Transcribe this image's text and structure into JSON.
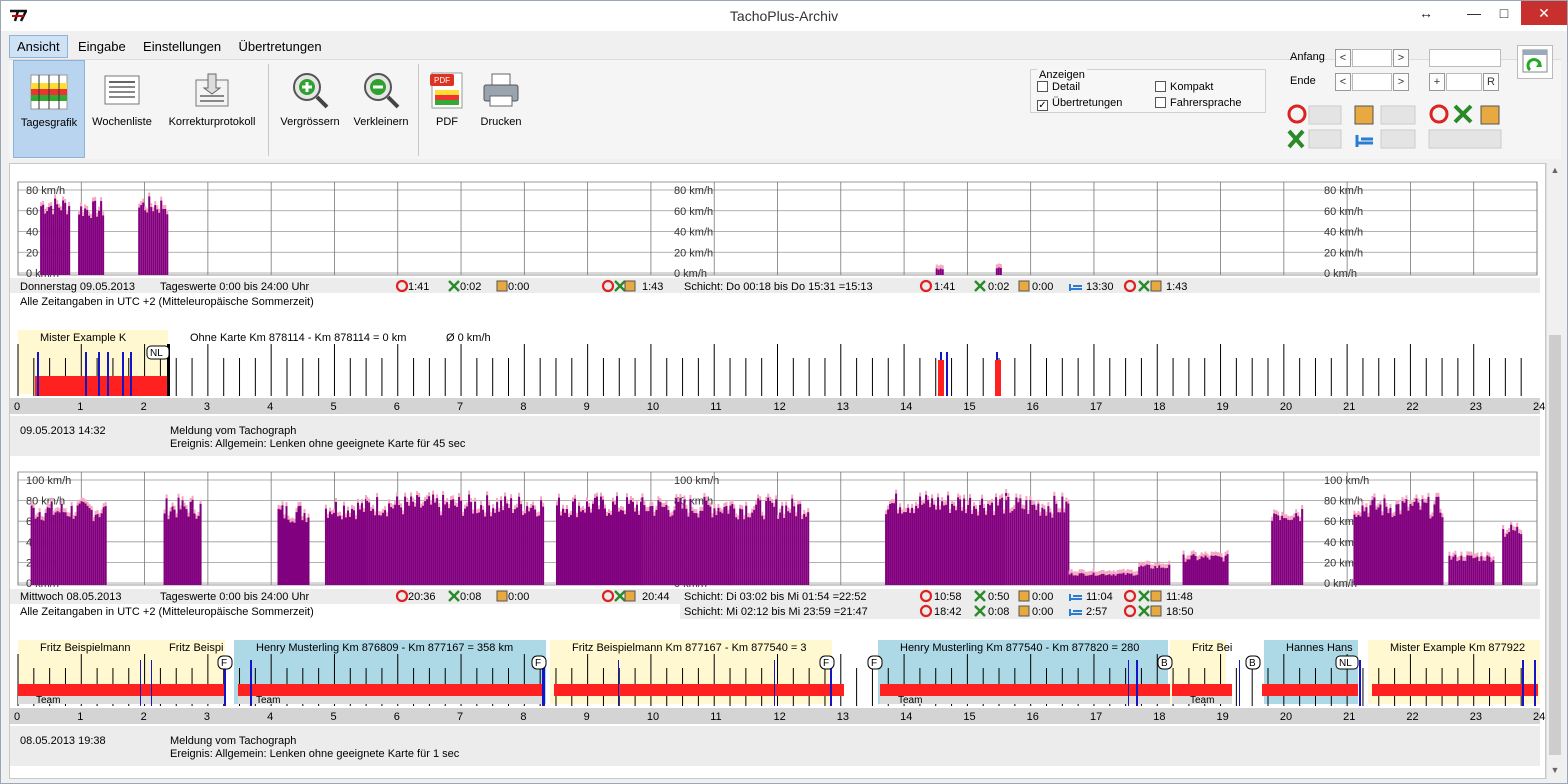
{
  "window": {
    "title": "TachoPlus-Archiv",
    "restore_glyph": "↔",
    "minimize_glyph": "—",
    "maximize_glyph": "□",
    "close_glyph": "✕"
  },
  "menu": {
    "items": [
      "Ansicht",
      "Eingabe",
      "Einstellungen",
      "Übertretungen"
    ],
    "active": "Ansicht"
  },
  "ribbon": {
    "buttons": [
      {
        "label": "Tagesgrafik",
        "icon": "tagesgrafik-icon",
        "selected": true
      },
      {
        "label": "Wochenliste",
        "icon": "wochenliste-icon"
      },
      {
        "label": "Korrekturprotokoll",
        "icon": "korrekturprotokoll-icon"
      },
      {
        "label": "Vergrössern",
        "icon": "zoom-in-icon"
      },
      {
        "label": "Verkleinern",
        "icon": "zoom-out-icon"
      },
      {
        "label": "PDF",
        "icon": "pdf-icon"
      },
      {
        "label": "Drucken",
        "icon": "printer-icon"
      }
    ],
    "anzeigen": {
      "title": "Anzeigen",
      "options": [
        {
          "label": "Detail",
          "checked": false
        },
        {
          "label": "Kompakt",
          "checked": false
        },
        {
          "label": "Übertretungen",
          "checked": true
        },
        {
          "label": "Fahrersprache",
          "checked": false
        }
      ]
    },
    "range": {
      "anfang_label": "Anfang",
      "ende_label": "Ende",
      "plus": "+",
      "r": "R",
      "prev": "<",
      "next": ">"
    }
  },
  "colors": {
    "purple": "#800080",
    "pink": "#f4a6c0",
    "red": "#ff2020",
    "blue": "#1414c8",
    "lightblue": "#add8e6",
    "yellow": "#fff8d0",
    "grey": "#d4d4d4",
    "accent": "#2d7fd2"
  },
  "speed_labels_1": [
    "80 km/h",
    "60 km/h",
    "40 km/h",
    "20 km/h",
    "0 km/h"
  ],
  "speed_labels_2": [
    "100 km/h",
    "80 km/h",
    "60 km/h",
    "40 km/h",
    "20 km/h",
    "0 km/h"
  ],
  "hours": [
    "0",
    "1",
    "2",
    "3",
    "4",
    "5",
    "6",
    "7",
    "8",
    "9",
    "10",
    "11",
    "12",
    "13",
    "14",
    "15",
    "16",
    "17",
    "18",
    "19",
    "20",
    "21",
    "22",
    "23",
    "24"
  ],
  "day1": {
    "date": "Donnerstag 09.05.2013",
    "tageswerte": "Tageswerte 0:00 bis 24:00 Uhr",
    "v_drive": "1:41",
    "v_work": "0:02",
    "v_avail": "0:00",
    "v_total": "1:43",
    "schicht": "Schicht: Do 00:18 bis Do 15:31 =15:13",
    "s_drive": "1:41",
    "s_work": "0:02",
    "s_avail": "0:00",
    "s_rest": "13:30",
    "s_total": "1:43",
    "utc": "Alle Zeitangaben in UTC +2 (Mitteleuropäische Sommerzeit)",
    "driver1": "Mister Example K",
    "nokarte": "Ohne Karte Km 878114 - Km 878114 = 0 km",
    "avg": "Ø 0 km/h",
    "country": "NL",
    "event_time": "09.05.2013 14:32",
    "event_title": "Meldung vom Tachograph",
    "event_text": "Ereignis: Allgemein: Lenken ohne geeignete Karte für 45 sec"
  },
  "day2": {
    "date": "Mittwoch 08.05.2013",
    "tageswerte": "Tageswerte 0:00 bis 24:00 Uhr",
    "v_drive": "20:36",
    "v_work": "0:08",
    "v_avail": "0:00",
    "v_total": "20:44",
    "schicht1": "Schicht: Di 03:02 bis Mi 01:54 =22:52",
    "s1_drive": "10:58",
    "s1_work": "0:50",
    "s1_avail": "0:00",
    "s1_rest": "11:04",
    "s1_total": "11:48",
    "schicht2": "Schicht: Mi 02:12 bis Mi 23:59 =21:47",
    "s2_drive": "18:42",
    "s2_work": "0:08",
    "s2_avail": "0:00",
    "s2_rest": "2:57",
    "s2_total": "18:50",
    "utc": "Alle Zeitangaben in UTC +2 (Mitteleuropäische Sommerzeit)",
    "segments": [
      "Fritz Beispielmann",
      "Fritz Beispi",
      "Henry Musterling Km 876809 - Km 877167 = 358 km",
      "Fritz Beispielmann Km 877167 - Km 877540 = 3",
      "Henry Musterling Km 877540 - Km 877820 = 280",
      "Fritz Bei",
      "Hannes Hans",
      "Mister Example Km 877922"
    ],
    "team": "Team",
    "marker_f": "F",
    "marker_b": "B",
    "country": "NL",
    "event_time": "08.05.2013 19:38",
    "event_title": "Meldung vom Tachograph",
    "event_text": "Ereignis: Allgemein: Lenken ohne geeignete Karte für 1 sec"
  }
}
